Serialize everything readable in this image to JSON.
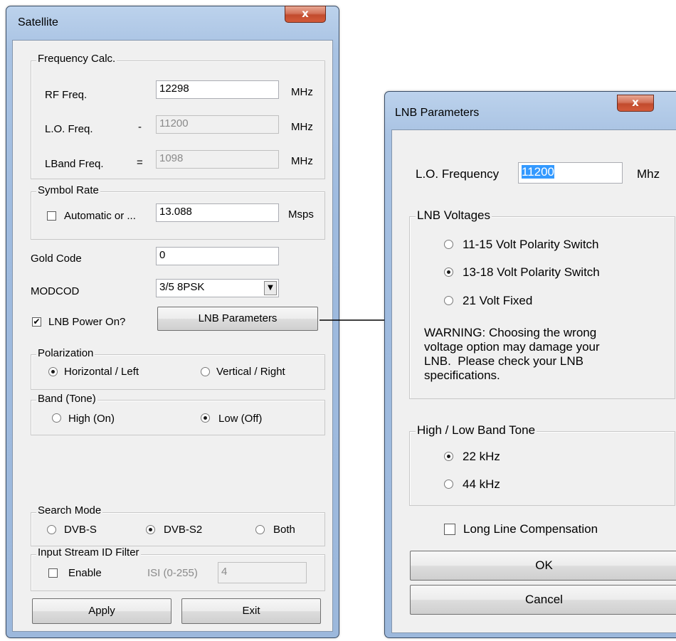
{
  "satellite": {
    "title": "Satellite",
    "close_glyph": "x",
    "freq": {
      "legend": "Frequency Calc.",
      "rf_label": "RF Freq.",
      "rf_value": "12298",
      "rf_unit": "MHz",
      "lo_label": "L.O. Freq.",
      "lo_op": "-",
      "lo_value": "11200",
      "lo_unit": "MHz",
      "lband_label": "LBand Freq.",
      "lband_op": "=",
      "lband_value": "1098",
      "lband_unit": "MHz"
    },
    "symbol": {
      "legend": "Symbol Rate",
      "auto_label": "Automatic or ...",
      "auto_checked": false,
      "value": "13.088",
      "unit": "Msps"
    },
    "gold_label": "Gold Code",
    "gold_value": "0",
    "modcod_label": "MODCOD",
    "modcod_value": "3/5 8PSK",
    "lnb_power_label": "LNB Power On?",
    "lnb_power_checked": true,
    "lnb_params_button": "LNB Parameters",
    "polarization": {
      "legend": "Polarization",
      "opt1": "Horizontal / Left",
      "opt2": "Vertical / Right",
      "selected": "opt1"
    },
    "band": {
      "legend": "Band (Tone)",
      "opt1": "High (On)",
      "opt2": "Low (Off)",
      "selected": "opt2"
    },
    "search": {
      "legend": "Search Mode",
      "opt1": "DVB-S",
      "opt2": "DVB-S2",
      "opt3": "Both",
      "selected": "opt2"
    },
    "isi": {
      "legend": "Input Stream ID Filter",
      "enable_label": "Enable",
      "isi_label": "ISI (0-255)",
      "isi_value": "4"
    },
    "apply_button": "Apply",
    "exit_button": "Exit"
  },
  "lnb": {
    "title": "LNB Parameters",
    "close_glyph": "x",
    "lo_label": "L.O. Frequency",
    "lo_value": "11200",
    "lo_unit": "Mhz",
    "voltages": {
      "legend": "LNB Voltages",
      "opt1": "11-15 Volt Polarity Switch",
      "opt2": "13-18 Volt Polarity Switch",
      "opt3": "21 Volt Fixed",
      "selected": "opt2",
      "warning": [
        "WARNING: Choosing the wrong",
        "voltage option may damage your",
        "LNB.  Please check your LNB",
        "specifications."
      ]
    },
    "tone": {
      "legend": "High / Low Band Tone",
      "opt1": "22 kHz",
      "opt2": "44 kHz",
      "selected": "opt1"
    },
    "long_line_label": "Long Line Compensation",
    "ok_button": "OK",
    "cancel_button": "Cancel"
  }
}
